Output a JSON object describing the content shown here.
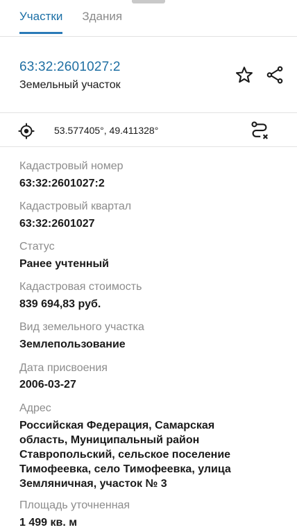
{
  "tabs": [
    {
      "label": "Участки"
    },
    {
      "label": "Здания"
    }
  ],
  "header": {
    "cadastral_number": "63:32:2601027:2",
    "object_type": "Земельный участок",
    "favorite_icon": "star-outline-icon",
    "share_icon": "share-icon"
  },
  "location": {
    "locate_icon": "crosshair-icon",
    "coordinates": "53.577405°, 49.411328°",
    "route_icon": "route-icon"
  },
  "fields": [
    {
      "label": "Кадастровый номер",
      "value": "63:32:2601027:2"
    },
    {
      "label": "Кадастровый квартал",
      "value": "63:32:2601027"
    },
    {
      "label": "Статус",
      "value": "Ранее учтенный"
    },
    {
      "label": "Кадастровая стоимость",
      "value": "839 694,83 руб."
    },
    {
      "label": "Вид земельного участка",
      "value": "Землепользование"
    },
    {
      "label": "Дата присвоения",
      "value": "2006-03-27"
    },
    {
      "label": "Адрес",
      "value_lines": [
        "Российская Федерация, Самарская",
        "область, Муниципальный район",
        "Ставропольский, сельское поселение",
        "Тимофеевка, село Тимофеевка, улица",
        "Земляничная, участок № 3"
      ]
    },
    {
      "label": "Площадь уточненная",
      "value": "1 499 кв. м"
    }
  ],
  "colors": {
    "accent": "#1f6fa3",
    "label_gray": "#8c8c8c",
    "divider": "#e2e2e2"
  }
}
